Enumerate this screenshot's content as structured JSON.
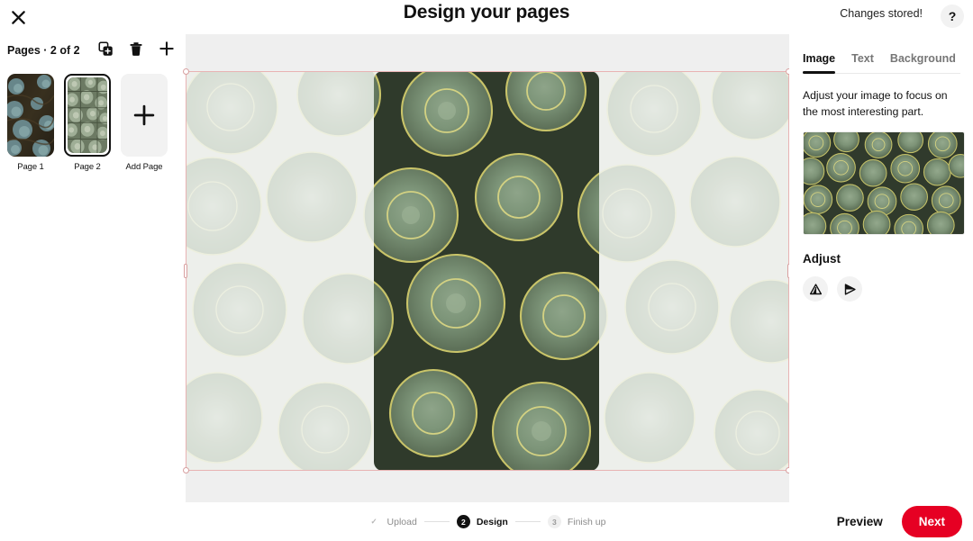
{
  "header": {
    "close_icon": "close-icon",
    "title": "Design your pages",
    "status": "Changes stored!",
    "help_icon": "question-mark-icon"
  },
  "sidebar": {
    "pages_label": "Pages · 2 of 2",
    "tools": [
      {
        "name": "duplicate-page-button",
        "icon": "duplicate-icon"
      },
      {
        "name": "delete-page-button",
        "icon": "trash-icon"
      },
      {
        "name": "add-page-button",
        "icon": "plus-icon"
      }
    ],
    "thumbnails": [
      {
        "label": "Page 1",
        "selected": false
      },
      {
        "label": "Page 2",
        "selected": true
      }
    ],
    "add_page_label": "Add Page",
    "add_page_icon": "plus-icon"
  },
  "canvas": {
    "crop_handles": [
      "top-left",
      "top-right",
      "bottom-left",
      "bottom-right",
      "left-edge",
      "right-edge"
    ]
  },
  "panel": {
    "tabs": [
      {
        "label": "Image",
        "active": true
      },
      {
        "label": "Text",
        "active": false
      },
      {
        "label": "Background",
        "active": false
      }
    ],
    "description": "Adjust your image to focus on the most interesting part.",
    "adjust_title": "Adjust",
    "adjust_buttons": [
      {
        "name": "flip-vertical-button",
        "icon": "triangle-up-icon"
      },
      {
        "name": "flip-horizontal-button",
        "icon": "triangle-right-icon"
      }
    ]
  },
  "stepper": {
    "steps": [
      {
        "num": "✓",
        "label": "Upload",
        "state": "done"
      },
      {
        "num": "2",
        "label": "Design",
        "state": "active"
      },
      {
        "num": "3",
        "label": "Finish up",
        "state": "todo"
      }
    ]
  },
  "footer": {
    "preview_label": "Preview",
    "next_label": "Next"
  },
  "colors": {
    "accent_red": "#e60023",
    "active_dark": "#111111",
    "canvas_bg": "#efefef",
    "crop_border": "#e8b3b3"
  }
}
